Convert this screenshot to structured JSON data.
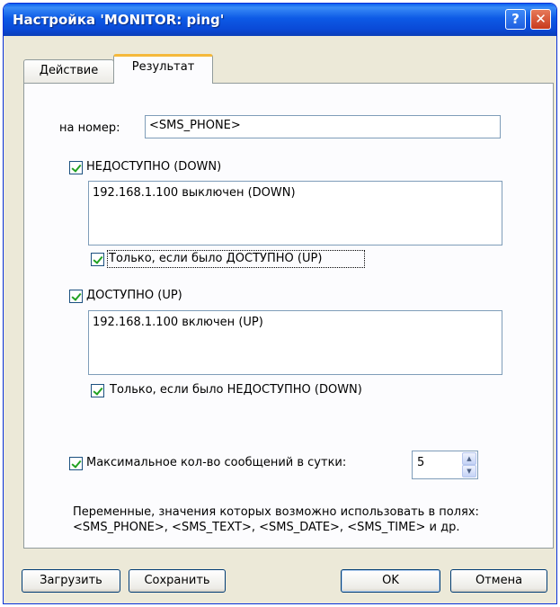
{
  "window": {
    "title": "Настройка 'MONITOR: ping'",
    "help_label": "?",
    "close_label": "✕"
  },
  "tabs": [
    {
      "label": "Действие",
      "selected": false
    },
    {
      "label": "Результат",
      "selected": true
    }
  ],
  "form": {
    "phone_label": "на номер:",
    "phone_value": "<SMS_PHONE>",
    "down": {
      "label": "НЕДОСТУПНО (DOWN)",
      "checked": true,
      "message": "192.168.1.100 выключен (DOWN)",
      "only_if_label": "Только, если было ДОСТУПНО (UP)",
      "only_if_checked": true
    },
    "up": {
      "label": "ДОСТУПНО (UP)",
      "checked": true,
      "message": "192.168.1.100 включен (UP)",
      "only_if_label": "Только, если было НЕДОСТУПНО (DOWN)",
      "only_if_checked": true
    },
    "max_label": "Максимальное кол-во сообщений в сутки:",
    "max_checked": true,
    "max_value": "5"
  },
  "hint": {
    "line1": "Переменные, значения которых возможно использовать в полях:",
    "line2": "<SMS_PHONE>, <SMS_TEXT>, <SMS_DATE>, <SMS_TIME> и др."
  },
  "buttons": {
    "load": "Загрузить",
    "save": "Сохранить",
    "ok": "OK",
    "cancel": "Отмена"
  }
}
